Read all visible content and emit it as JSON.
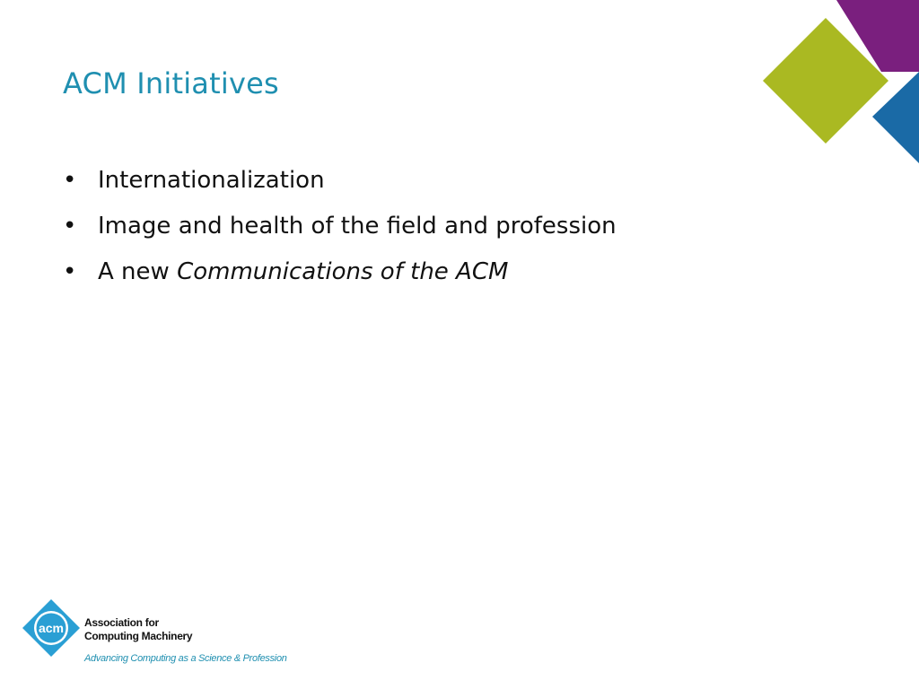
{
  "slide": {
    "title": "ACM Initiatives",
    "bullets": [
      {
        "text": "Internationalization"
      },
      {
        "text": "Image and health of the field and profession"
      },
      {
        "prefix": "A new ",
        "italic": "Communications of the ACM"
      }
    ],
    "bullet_symbol": "•"
  },
  "logo": {
    "mark_text": "acm",
    "name_line1": "Association for",
    "name_line2": "Computing Machinery",
    "tagline": "Advancing Computing as a Science & Profession"
  },
  "colors": {
    "title": "#1f8fb0",
    "purple": "#7a1f7e",
    "lime": "#aab922",
    "blue": "#1a6aa6",
    "logo_blue": "#2a9fd4"
  }
}
